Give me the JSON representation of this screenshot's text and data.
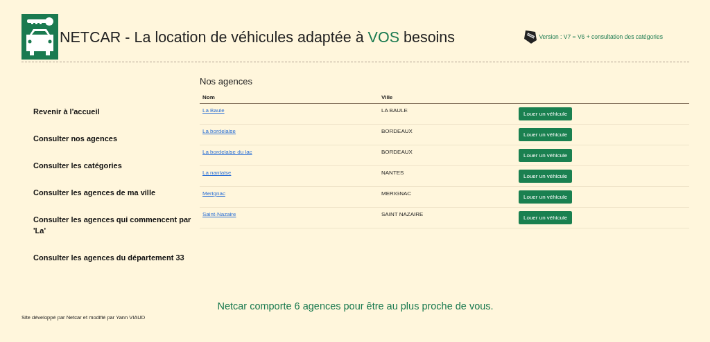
{
  "header": {
    "title": [
      {
        "text": "NETCAR - La location de véhicules adaptée à ",
        "highlight": false
      },
      {
        "text": "VOS",
        "highlight": true
      },
      {
        "text": " besoins",
        "highlight": false
      }
    ],
    "version": "Version : V7 = V6 + consultation des catégories"
  },
  "sidebar": {
    "items": [
      "Revenir à l'accueil",
      "Consulter nos agences",
      "Consulter les catégories",
      "Consulter les agences de ma ville",
      "Consulter les agences qui commencent par 'La'",
      "Consulter les agences du département 33"
    ]
  },
  "main": {
    "heading": "Nos agences",
    "table": {
      "columns": [
        "Nom",
        "Ville"
      ],
      "rows": [
        {
          "name": "La Baule",
          "city": "LA BAULE",
          "action": "Louer un véhicule"
        },
        {
          "name": "La bordelaise",
          "city": "BORDEAUX",
          "action": "Louer un véhicule"
        },
        {
          "name": "La bordelaise du lac",
          "city": "BORDEAUX",
          "action": "Louer un véhicule"
        },
        {
          "name": "La nantaise",
          "city": "NANTES",
          "action": "Louer un véhicule"
        },
        {
          "name": "Merignac",
          "city": "MERIGNAC",
          "action": "Louer un véhicule"
        },
        {
          "name": "Saint-Nazaire",
          "city": "SAINT NAZAIRE",
          "action": "Louer un véhicule"
        }
      ]
    }
  },
  "footer": {
    "message": "Netcar comporte 6 agences pour être au plus proche de vous.",
    "credit": "Site développé par Netcar et modifié par Yann VIAUD"
  }
}
